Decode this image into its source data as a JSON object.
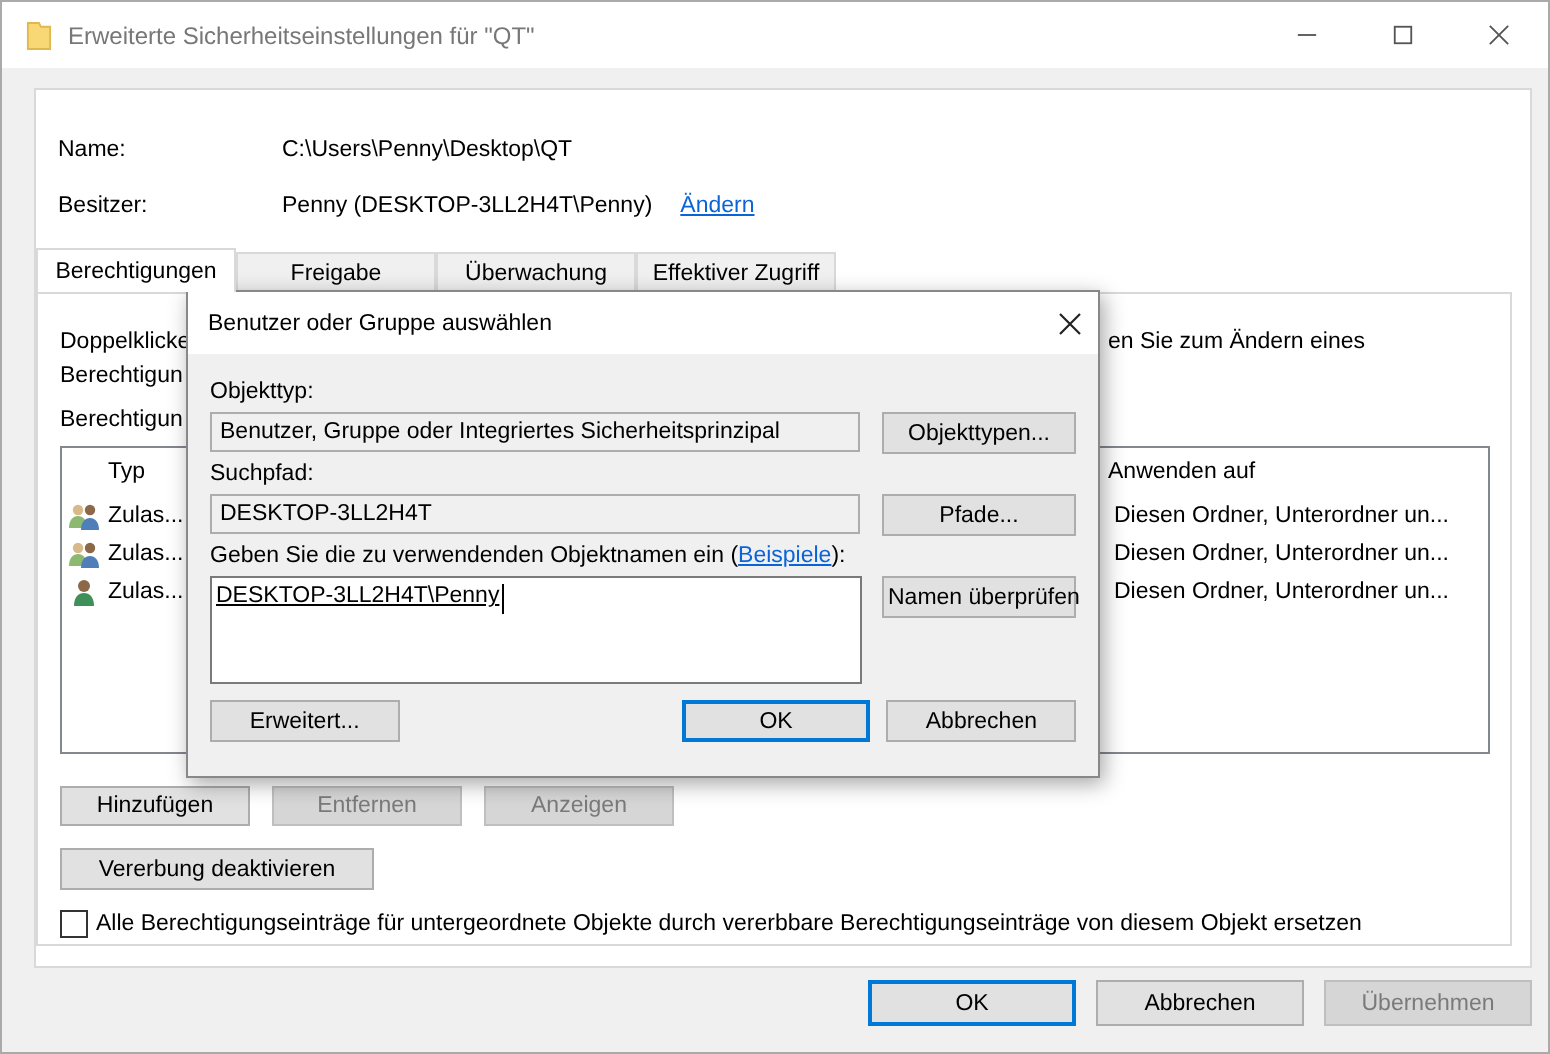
{
  "window": {
    "title": "Erweiterte Sicherheitseinstellungen für \"QT\""
  },
  "info": [
    {
      "label": "Name:",
      "value": "C:\\Users\\Penny\\Desktop\\QT"
    },
    {
      "label": "Besitzer:",
      "value": "Penny (DESKTOP-3LL2H4T\\Penny)",
      "link": "Ändern"
    }
  ],
  "tabs": [
    {
      "label": "Berechtigungen",
      "selected": true
    },
    {
      "label": "Freigabe",
      "selected": false
    },
    {
      "label": "Überwachung",
      "selected": false
    },
    {
      "label": "Effektiver Zugriff",
      "selected": false
    }
  ],
  "description": {
    "left_lines": [
      "Doppelklicke",
      "Berechtigun"
    ],
    "right": "en Sie zum Ändern eines"
  },
  "list_label": "Berechtigun",
  "table": {
    "columns": [
      "Typ",
      "Anwenden auf"
    ],
    "rows": [
      {
        "kind": "group",
        "type": "Zulas...",
        "applies_to": "Diesen Ordner, Unterordner un..."
      },
      {
        "kind": "group",
        "type": "Zulas...",
        "applies_to": "Diesen Ordner, Unterordner un..."
      },
      {
        "kind": "user",
        "type": "Zulas...",
        "applies_to": "Diesen Ordner, Unterordner un..."
      }
    ]
  },
  "entry_buttons": [
    {
      "label": "Hinzufügen",
      "disabled": false
    },
    {
      "label": "Entfernen",
      "disabled": true
    },
    {
      "label": "Anzeigen",
      "disabled": true
    }
  ],
  "inheritance_button": "Vererbung deaktivieren",
  "replace_checkbox": {
    "label": "Alle Berechtigungseinträge für untergeordnete Objekte durch vererbbare Berechtigungseinträge von diesem Objekt ersetzen",
    "checked": false
  },
  "footer_buttons": [
    {
      "label": "OK",
      "default": true,
      "disabled": false
    },
    {
      "label": "Abbrechen",
      "default": false,
      "disabled": false
    },
    {
      "label": "Übernehmen",
      "default": false,
      "disabled": true
    }
  ],
  "dialog": {
    "title": "Benutzer oder Gruppe auswählen",
    "object_type": {
      "label": "Objekttyp:",
      "value": "Benutzer, Gruppe oder Integriertes Sicherheitsprinzipal",
      "button": "Objekttypen..."
    },
    "search_path": {
      "label": "Suchpfad:",
      "value": "DESKTOP-3LL2H4T",
      "button": "Pfade..."
    },
    "names": {
      "label": "Geben Sie die zu verwendenden Objektnamen ein (",
      "link": "Beispiele",
      "label_end": "):",
      "value": "DESKTOP-3LL2H4T\\Penny",
      "button": "Namen überprüfen"
    },
    "buttons": [
      {
        "label": "Erweitert...",
        "default": false
      },
      {
        "label": "OK",
        "default": true
      },
      {
        "label": "Abbrechen",
        "default": false
      }
    ]
  }
}
